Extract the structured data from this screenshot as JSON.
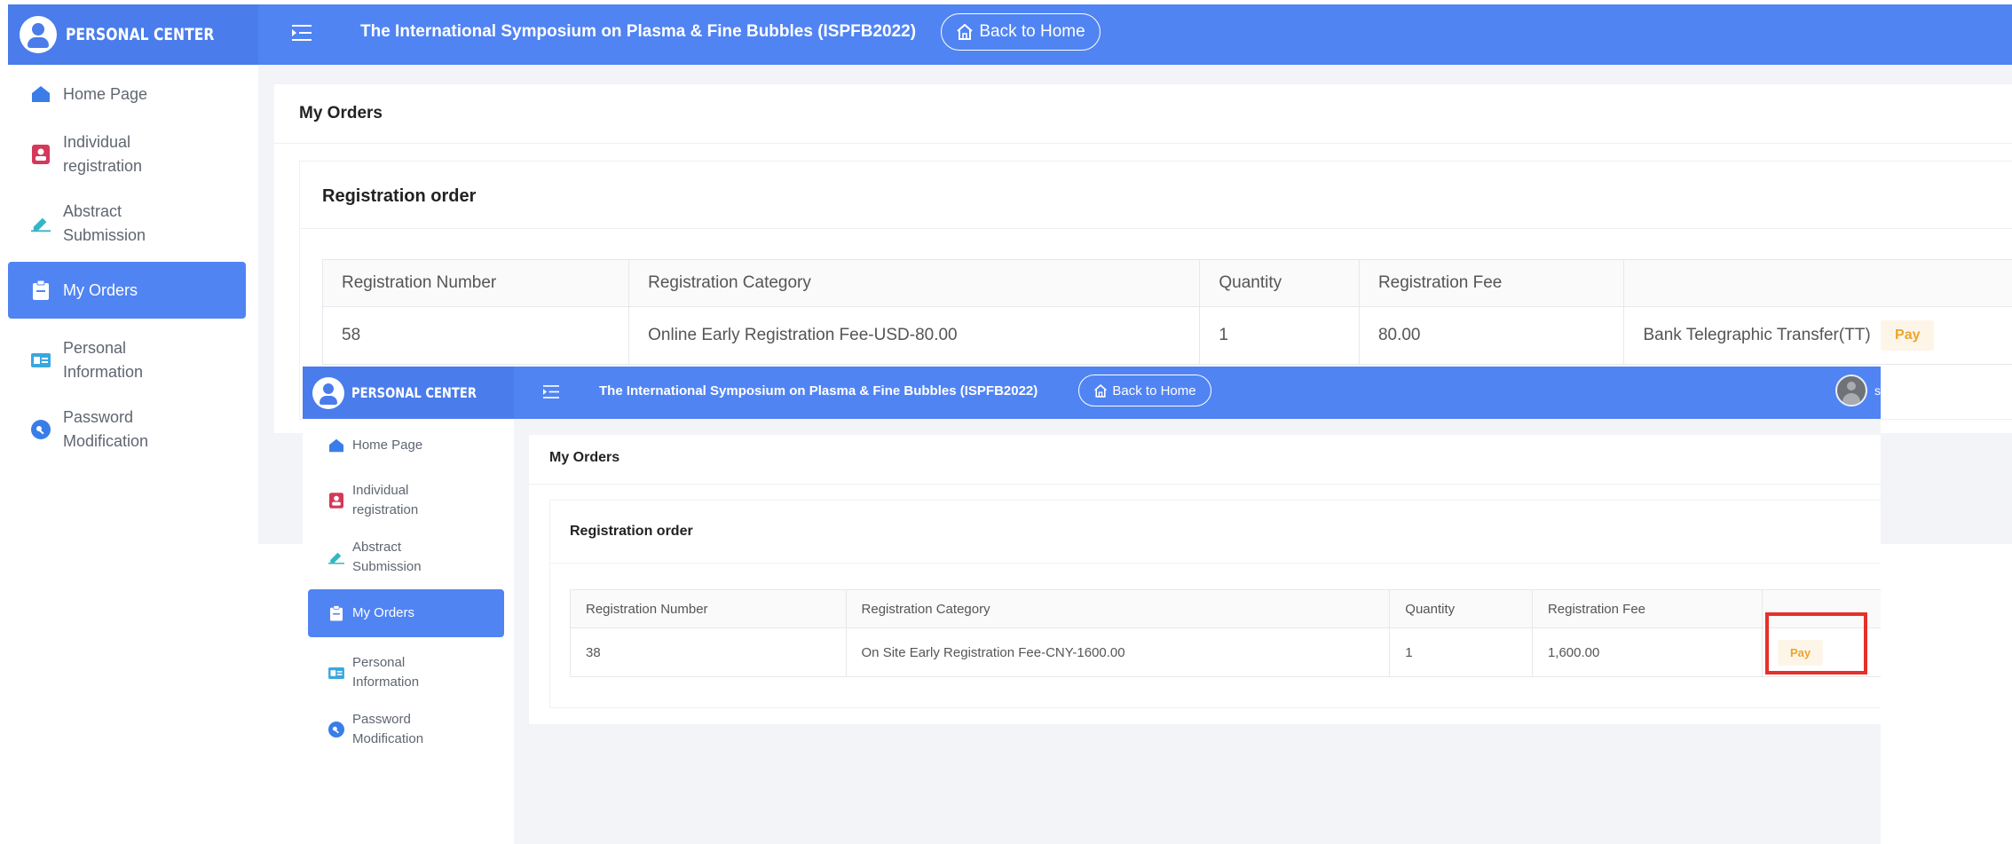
{
  "brand": "PERSONAL CENTER",
  "header": {
    "title": "The International Symposium on Plasma & Fine Bubbles (ISPFB2022)",
    "back_home": "Back to Home",
    "username": "s"
  },
  "sidebar": {
    "items": [
      {
        "label": "Home Page",
        "icon": "home-icon"
      },
      {
        "label": "Individual registration",
        "icon": "id-card-icon"
      },
      {
        "label": "Abstract Submission",
        "icon": "pen-icon"
      },
      {
        "label": "My Orders",
        "icon": "clipboard-icon",
        "active": true
      },
      {
        "label": "Personal Information",
        "icon": "user-card-icon"
      },
      {
        "label": "Password Modification",
        "icon": "key-icon"
      }
    ]
  },
  "page_title": "My Orders",
  "section_title": "Registration order",
  "table_headers": [
    "Registration Number",
    "Registration Category",
    "Quantity",
    "Registration Fee",
    ""
  ],
  "back_order": {
    "number": "58",
    "category": "Online Early Registration Fee-USD-80.00",
    "quantity": "1",
    "fee": "80.00",
    "payment_method": "Bank Telegraphic Transfer(TT)",
    "pay_label": "Pay"
  },
  "front_order": {
    "number": "38",
    "category": "On Site Early Registration Fee-CNY-1600.00",
    "quantity": "1",
    "fee": "1,600.00",
    "pay_label": "Pay"
  },
  "colors": {
    "header_blue": "#5184f3",
    "pay_text": "#f0a22b",
    "highlight": "#e6302b"
  }
}
